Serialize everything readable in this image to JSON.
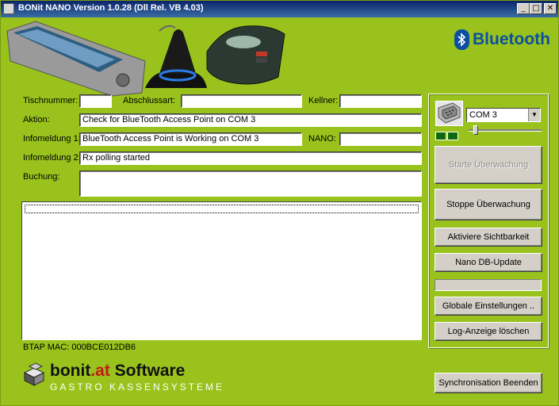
{
  "window": {
    "title": "BONit NANO Version 1.0.28 (Dll Rel. VB 4.03)",
    "minimize": "_",
    "maximize": "□",
    "close": "✕"
  },
  "brand": {
    "bluetooth": "Bluetooth"
  },
  "form": {
    "tischnummer_label": "Tischnummer:",
    "tischnummer_value": "",
    "abschlussart_label": "Abschlussart:",
    "abschlussart_value": "",
    "kellner_label": "Kellner:",
    "kellner_value": "",
    "aktion_label": "Aktion:",
    "aktion_value": "Check for BlueTooth Access Point on COM 3",
    "info1_label": "Infomeldung 1:",
    "info1_value": "BlueTooth Access Point is Working on COM 3",
    "nano_label": "NANO:",
    "nano_value": "",
    "info2_label": "Infomeldung 2:",
    "info2_value": "Rx polling started",
    "buchung_label": "Buchung:",
    "buchung_value": ""
  },
  "log": {
    "lines": []
  },
  "status": {
    "mac": "BTAP MAC: 000BCE012DB6"
  },
  "panel": {
    "port_selected": "COM 3",
    "start_label": "Starte Überwachung",
    "stop_label": "Stoppe Überwachung",
    "visibility_label": "Aktiviere Sichtbarkeit",
    "dbupdate_label": "Nano DB-Update",
    "progress_fraction": 0,
    "settings_label": "Globale Einstellungen ..",
    "clearlog_label": "Log-Anzeige löschen"
  },
  "footer": {
    "logo_name_a": "bonit",
    "logo_name_b": ".at",
    "logo_name_c": " Software",
    "logo_tagline": "GASTRO KASSENSYSTEME",
    "sync_label": "Synchronisation Beenden"
  },
  "colors": {
    "background": "#99c31c",
    "titlebar": "#0a246a",
    "bluetooth": "#0b4fa0",
    "logo_dot": "#c41a1a"
  },
  "icons": [
    "app-icon",
    "pda-device-icon",
    "access-point-icon",
    "mobile-printer-icon",
    "bluetooth-icon",
    "serial-port-icon",
    "logo-cubes-icon"
  ]
}
